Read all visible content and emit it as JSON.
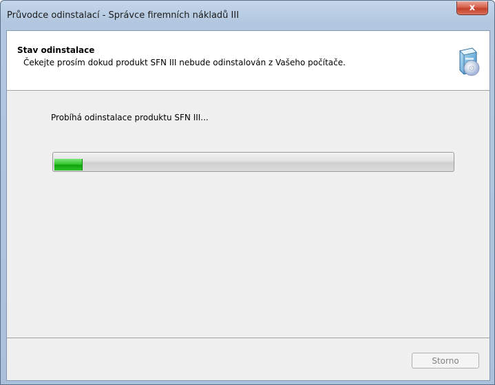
{
  "window": {
    "title": "Průvodce odinstalací - Správce firemních nákladů III",
    "close_glyph": "x"
  },
  "header": {
    "title": "Stav odinstalace",
    "description": "Čekejte prosím dokud produkt SFN III nebude odinstalován z Vašeho počítače.",
    "icon": "installer-cd-icon"
  },
  "main": {
    "status_text": "Probíhá odinstalace produktu SFN III...",
    "progress": 0.07
  },
  "footer": {
    "cancel_label": "Storno",
    "cancel_enabled": false
  },
  "colors": {
    "progress_green": "#22b81c",
    "close_red": "#c9442f"
  }
}
